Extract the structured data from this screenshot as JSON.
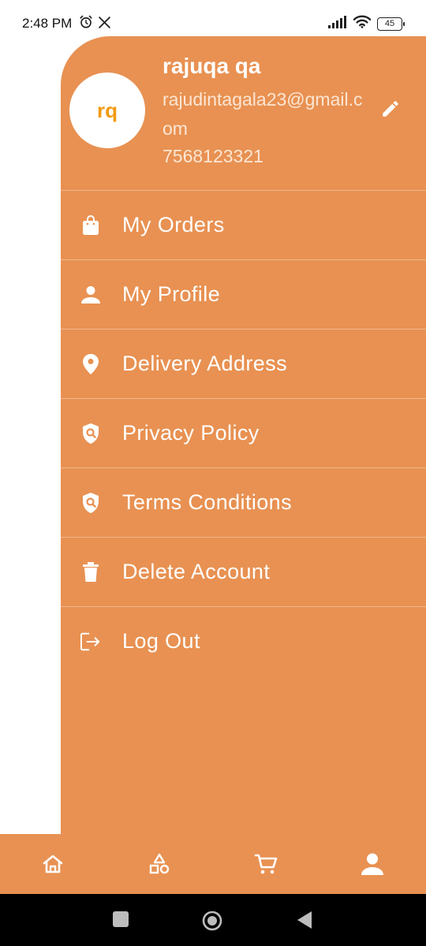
{
  "status_bar": {
    "time": "2:48 PM",
    "battery": "45",
    "icons": [
      "alarm-icon",
      "x-logo-icon",
      "signal-icon",
      "wifi-icon",
      "battery-icon"
    ]
  },
  "drawer": {
    "avatar_initials": "rq",
    "user_name": "rajuqa qa",
    "email": "rajudintagala23@gmail.com",
    "phone": "7568123321",
    "accent_color": "#E89152",
    "menu": [
      {
        "label": "My Orders",
        "icon": "shopping-bag-icon"
      },
      {
        "label": "My Profile",
        "icon": "person-icon"
      },
      {
        "label": "Delivery Address",
        "icon": "location-pin-icon"
      },
      {
        "label": "Privacy Policy",
        "icon": "shield-search-icon"
      },
      {
        "label": "Terms Conditions",
        "icon": "shield-search-icon"
      },
      {
        "label": "Delete Account",
        "icon": "trash-icon"
      },
      {
        "label": "Log Out",
        "icon": "logout-icon"
      }
    ]
  },
  "bottom_nav": {
    "items": [
      "home-icon",
      "categories-icon",
      "cart-icon",
      "account-icon"
    ]
  },
  "system_nav": {
    "items": [
      "recents-icon",
      "home-circle-icon",
      "back-icon"
    ]
  }
}
